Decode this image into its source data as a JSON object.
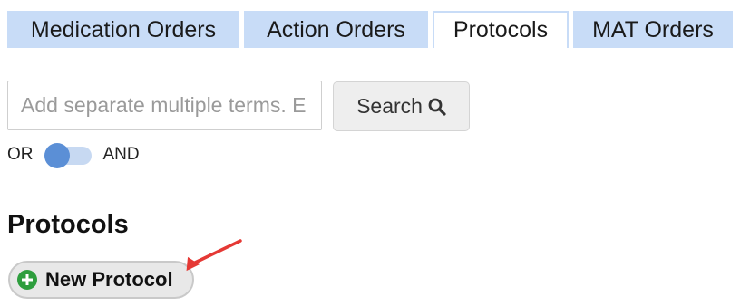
{
  "tabs": [
    {
      "label": "Medication Orders",
      "active": false
    },
    {
      "label": "Action Orders",
      "active": false
    },
    {
      "label": "Protocols",
      "active": true
    },
    {
      "label": "MAT Orders",
      "active": false
    }
  ],
  "search": {
    "placeholder": "Add separate multiple terms. E",
    "value": "",
    "button_label": "Search",
    "button_icon": "search-icon"
  },
  "toggle": {
    "left_label": "OR",
    "right_label": "AND",
    "state": "OR"
  },
  "section": {
    "title": "Protocols",
    "new_button_label": "New Protocol",
    "new_button_icon": "plus-circle-icon"
  },
  "annotation": {
    "icon": "red-arrow-icon",
    "color": "#e53935"
  },
  "colors": {
    "tab_bg": "#c8dcf7",
    "toggle_knob": "#5b8fd6",
    "plus_icon": "#2e9e3e"
  }
}
